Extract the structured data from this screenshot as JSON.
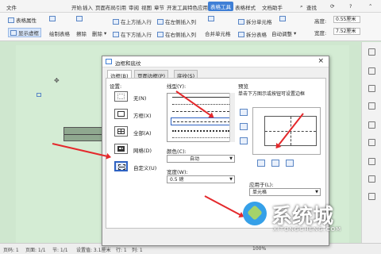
{
  "app": {
    "menu": [
      "文件",
      "开始",
      "插入",
      "页面布局",
      "引用",
      "审阅",
      "视图",
      "章节",
      "开发工具",
      "特色应用"
    ],
    "active_tab": "表格工具",
    "tab_style": "表格样式",
    "assistant": "文档助手",
    "search_label": "查找",
    "accent_color": "#3f7fd6"
  },
  "ribbon": {
    "table_props": "表格属性",
    "show_gridlines": "显示虚框",
    "draw_table": "绘制表格",
    "erase": "擦除",
    "delete": "删除",
    "insert_above": "在上方插入行",
    "insert_below": "在下方插入行",
    "insert_left": "在左侧插入列",
    "insert_right": "在右侧插入列",
    "merge": "合并单元格",
    "split_cell": "拆分单元格",
    "split_table": "拆分表格",
    "autofit": "自动调整",
    "height_label": "高度:",
    "height_value": "0.55厘米",
    "width_label": "宽度:",
    "width_value": "7.52厘米"
  },
  "dialog": {
    "title": "边框和底纹",
    "close": "×",
    "tabs": [
      "边框(B)",
      "页面边框(P)",
      "底纹(S)"
    ],
    "setting_label": "设置:",
    "settings": [
      "无(N)",
      "方框(X)",
      "全部(A)",
      "网格(D)",
      "自定义(U)"
    ],
    "line_style_label": "线型(Y):",
    "color_label": "颜色(C):",
    "color_value": "自动",
    "width_label": "宽度(W):",
    "width_value": "0.5 磅",
    "preview_label": "预览",
    "preview_hint": "单击下方图示或按钮可设置边框",
    "apply_label": "应用于(L):",
    "apply_value": "单元格"
  },
  "status": {
    "page": "页码: 1",
    "pages": "页面: 1/1",
    "section": "节: 1/1",
    "settings": "设置值: 3.1厘米",
    "row": "行: 1",
    "col": "列: 1",
    "zoom": "100%"
  },
  "watermark": {
    "text": "系统城",
    "url": "XITONGCHENG.COM"
  }
}
